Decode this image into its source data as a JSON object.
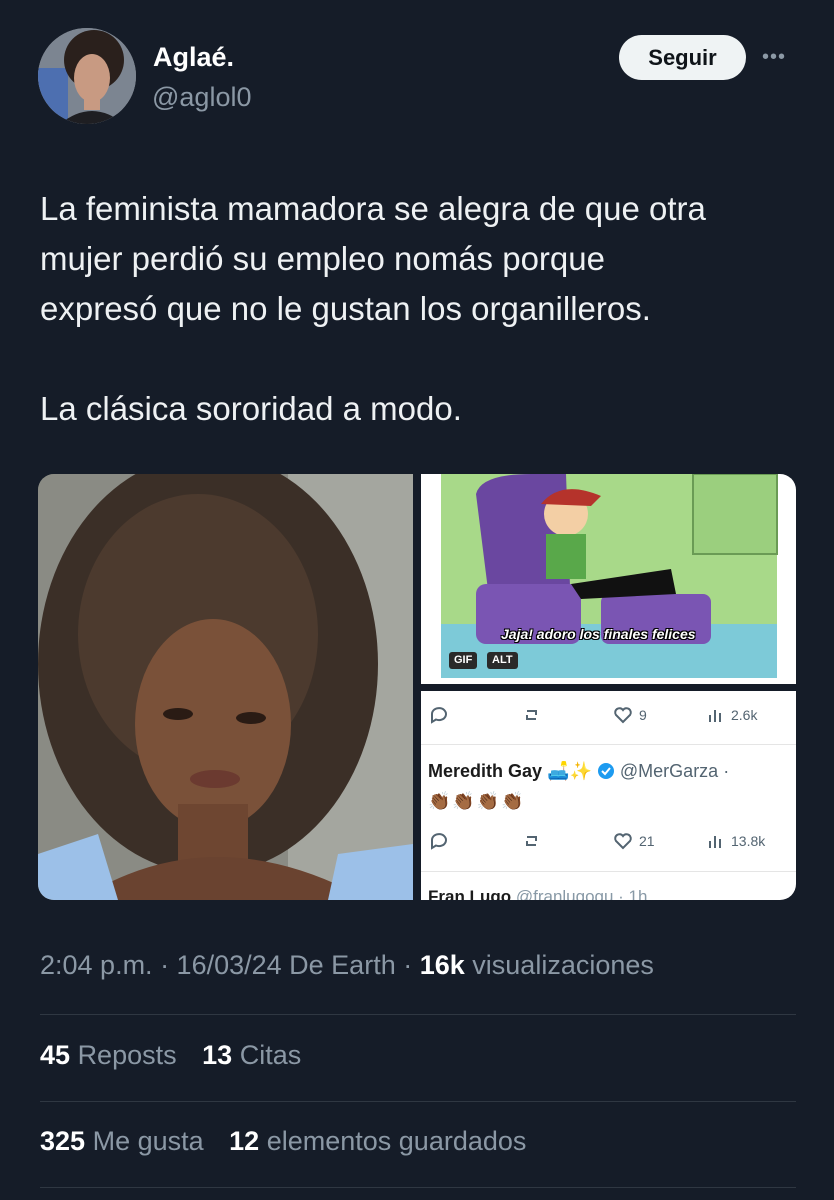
{
  "author": {
    "display_name": "Aglaé.",
    "handle": "@aglol0"
  },
  "actions": {
    "follow_label": "Seguir",
    "more_label": "•••"
  },
  "tweet": {
    "lines_para1": [
      "La feminista mamadora se alegra de que otra",
      "mujer perdió su empleo nomás porque",
      "expresó que no le gustan los organilleros."
    ],
    "para2": "La clásica sororidad a modo."
  },
  "media": {
    "gif_caption": "Jaja! adoro los finales felices",
    "gif_badge": "GIF",
    "alt_badge": "ALT",
    "screenshot": {
      "row1": {
        "likes": "9",
        "views": "2.6k"
      },
      "reply_author_name": "Meredith Gay",
      "reply_author_emoji": "🛋️✨",
      "reply_author_handle": "@MerGarza ·",
      "reply_text": "👏🏾👏🏾👏🏾👏🏾",
      "row2": {
        "likes": "21",
        "views": "13.8k"
      },
      "cut_name": "Fran Lugo",
      "cut_handle": "@franlugogu · 1h"
    }
  },
  "meta": {
    "time_date_source": "2:04 p.m. · 16/03/24 De Earth ·",
    "views_count": "16k",
    "views_label": "visualizaciones"
  },
  "stats": {
    "reposts_count": "45",
    "reposts_label": "Reposts",
    "quotes_count": "13",
    "quotes_label": "Citas",
    "likes_count": "325",
    "likes_label": "Me gusta",
    "bookmarks_count": "12",
    "bookmarks_label": "elementos guardados"
  },
  "colors": {
    "background": "#151c28",
    "text": "#e7e9ea",
    "muted": "#8b98a5",
    "follow_button": "#eff3f4",
    "verified": "#1d9bf0"
  }
}
